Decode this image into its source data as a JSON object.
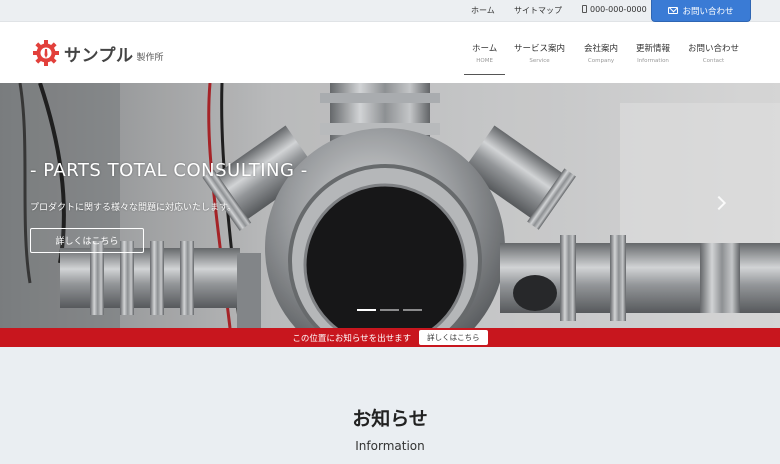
{
  "topbar": {
    "home": "ホーム",
    "sitemap": "サイトマップ",
    "phone": "000-000-0000",
    "contact_button": "お問い合わせ"
  },
  "header": {
    "logo_brand": "サンプル",
    "logo_sub": "製作所",
    "nav": [
      {
        "jp": "ホーム",
        "en": "HOME"
      },
      {
        "jp": "サービス案内",
        "en": "Service"
      },
      {
        "jp": "会社案内",
        "en": "Company"
      },
      {
        "jp": "更新情報",
        "en": "Information"
      },
      {
        "jp": "お問い合わせ",
        "en": "Contact"
      }
    ]
  },
  "hero": {
    "title": "- PARTS TOTAL CONSULTING -",
    "subtitle": "プロダクトに関する様々な問題に対応いたします。",
    "button": "詳しくはこちら",
    "slides": 3,
    "active_slide": 1
  },
  "notice": {
    "text": "この位置にお知らせを出せます",
    "button": "詳しくはこちら"
  },
  "info": {
    "title": "お知らせ",
    "subtitle": "Information"
  },
  "colors": {
    "accent_blue": "#3a7bd5",
    "notice_red": "#c8161e",
    "logo_red": "#e2403b"
  }
}
